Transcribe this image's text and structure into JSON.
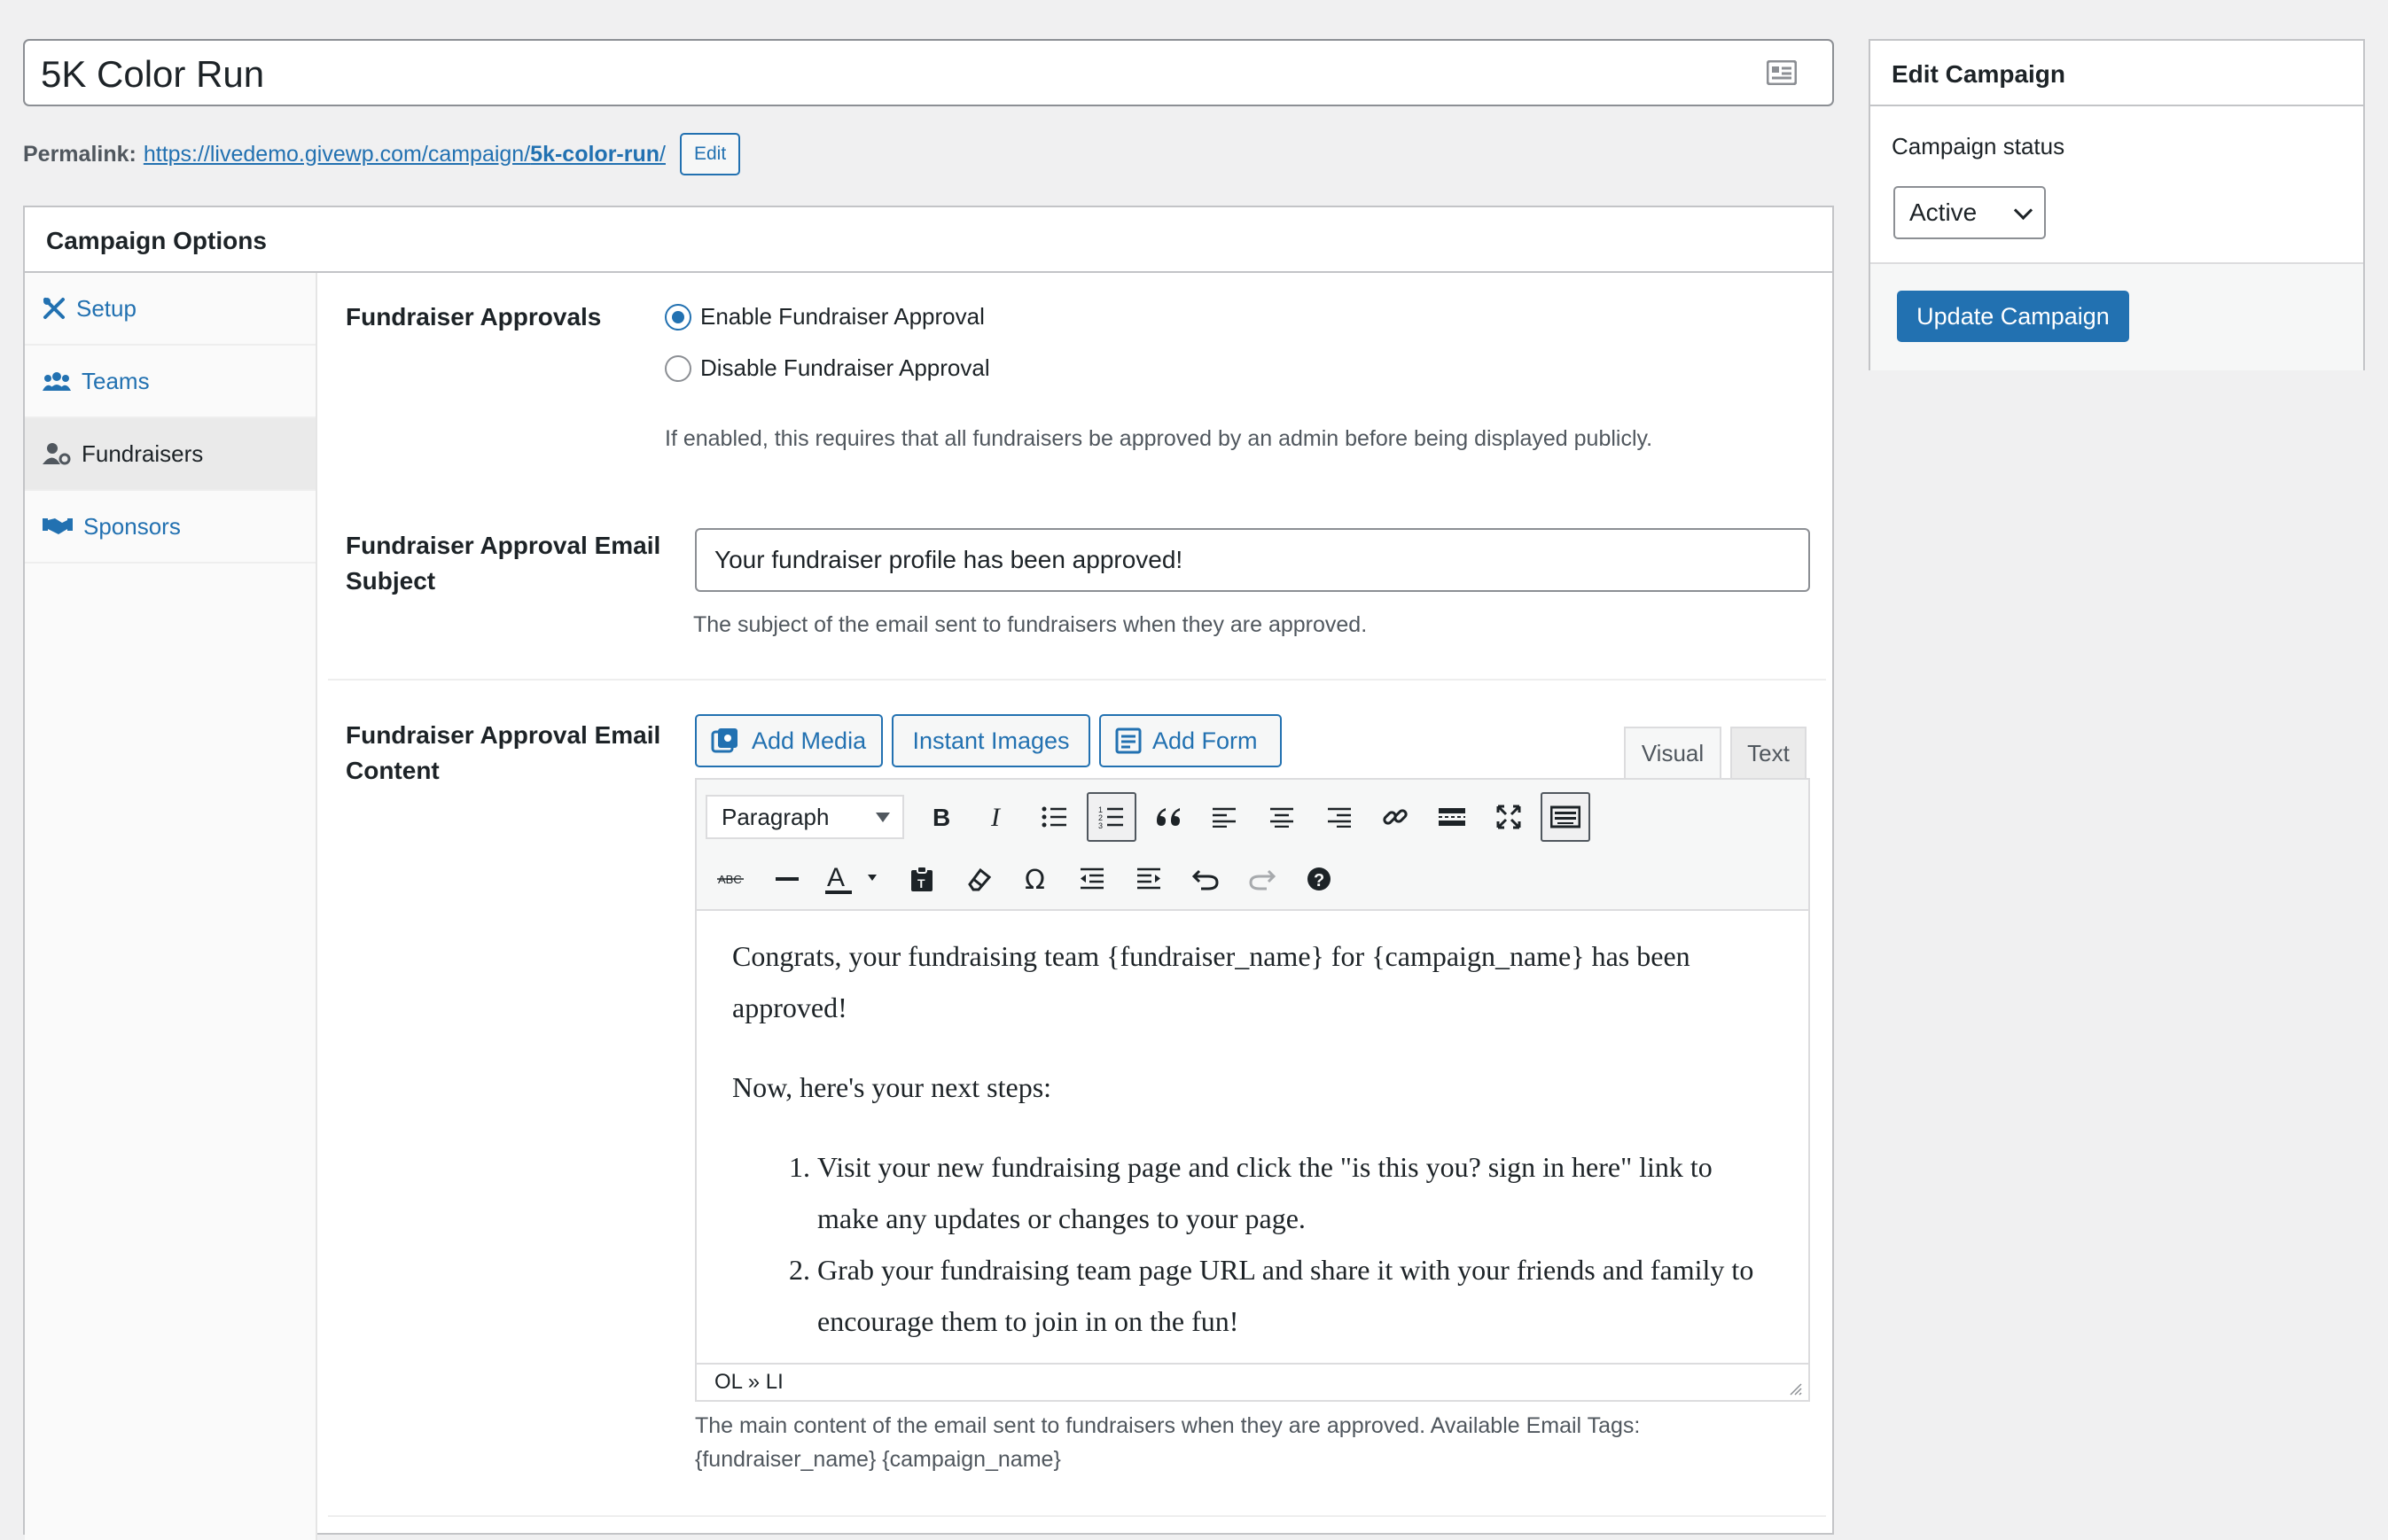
{
  "title": {
    "value": "5K Color Run"
  },
  "permalink": {
    "label": "Permalink:",
    "url_prefix": "https://livedemo.givewp.com/campaign/",
    "slug": "5k-color-run",
    "url_suffix": "/",
    "edit_label": "Edit"
  },
  "options": {
    "heading": "Campaign Options",
    "tabs": [
      {
        "label": "Setup",
        "icon": "tools-icon"
      },
      {
        "label": "Teams",
        "icon": "users-icon"
      },
      {
        "label": "Fundraisers",
        "icon": "user-cog-icon",
        "active": true
      },
      {
        "label": "Sponsors",
        "icon": "handshake-icon"
      }
    ],
    "approvals": {
      "label": "Fundraiser Approvals",
      "enable_label": "Enable Fundraiser Approval",
      "disable_label": "Disable Fundraiser Approval",
      "selected": "enable",
      "description": "If enabled, this requires that all fundraisers be approved by an admin before being displayed publicly."
    },
    "subject": {
      "label_line1": "Fundraiser Approval Email",
      "label_line2": "Subject",
      "value": "Your fundraiser profile has been approved!",
      "description": "The subject of the email sent to fundraisers when they are approved."
    },
    "content": {
      "label_line1": "Fundraiser Approval Email",
      "label_line2": "Content",
      "buttons": {
        "add_media": "Add Media",
        "instant_images": "Instant Images",
        "add_form": "Add Form"
      },
      "mode_tabs": {
        "visual": "Visual",
        "text": "Text"
      },
      "format_select": "Paragraph",
      "paragraph1": "Congrats, your fundraising team {fundraiser_name} for {campaign_name} has been approved!",
      "paragraph2": "Now, here's your next steps:",
      "list_items": [
        "Visit your new fundraising page and click the \"is this you? sign in here\" link to make any updates or changes to your page.",
        "Grab your fundraising team page URL and share it with your friends and family to encourage them to join in on the fun!"
      ],
      "status_path": "OL » LI",
      "description_line1": "The main content of the email sent to fundraisers when they are approved. Available Email Tags:",
      "description_line2": "{fundraiser_name} {campaign_name}"
    }
  },
  "sidebar": {
    "heading": "Edit Campaign",
    "status_label": "Campaign status",
    "status_value": "Active",
    "update_label": "Update Campaign"
  },
  "colors": {
    "accent": "#2271b1",
    "background": "#f0f0f1"
  }
}
